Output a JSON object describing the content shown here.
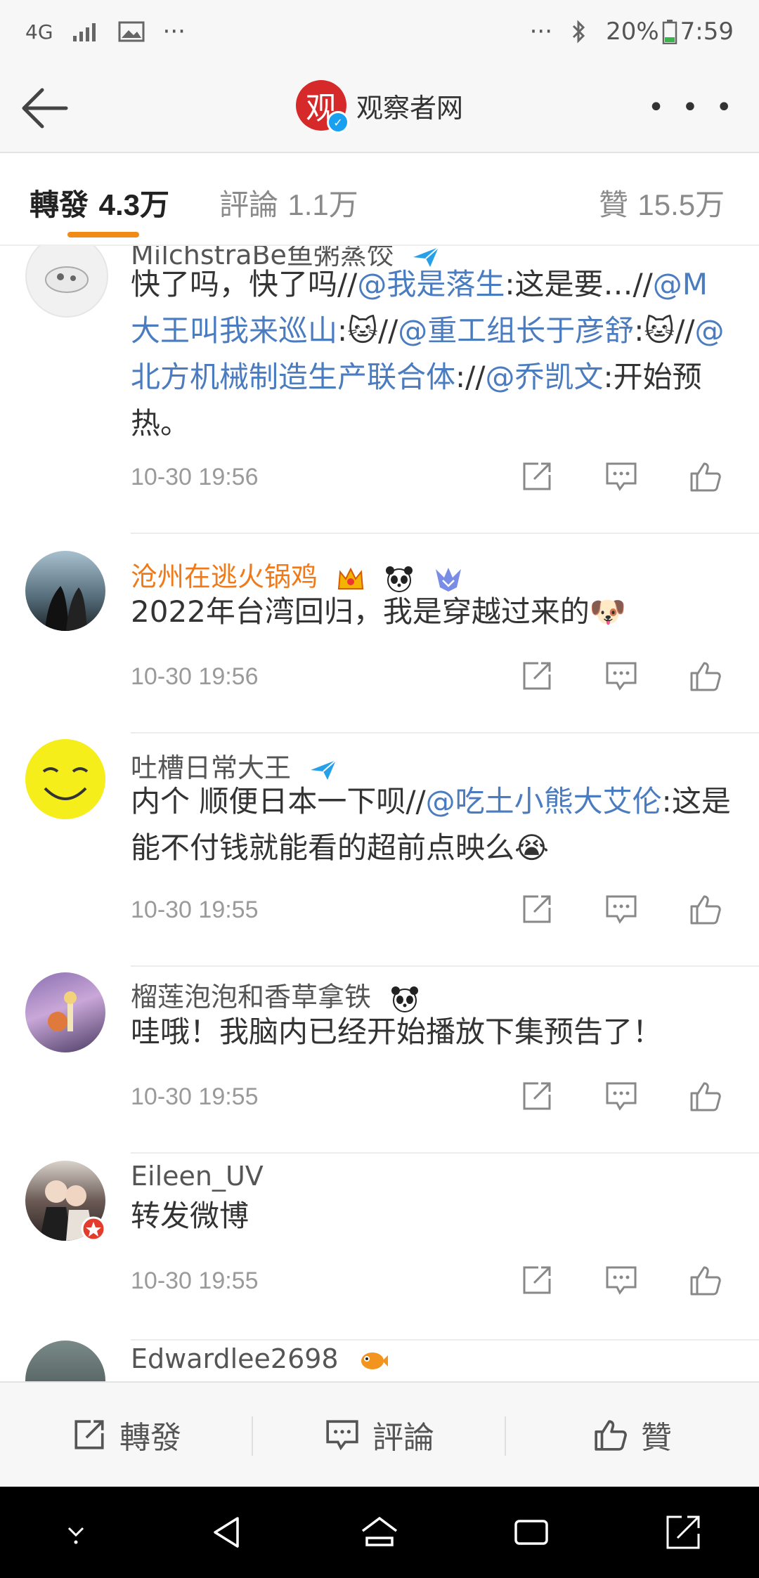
{
  "status_bar": {
    "network": "4G",
    "battery": "20%",
    "time": "7:59"
  },
  "header": {
    "title": "观察者网",
    "logo_text": "观"
  },
  "tabs": [
    {
      "label": "轉發",
      "count": "4.3万"
    },
    {
      "label": "評論",
      "count": "1.1万"
    },
    {
      "label": "贊",
      "count": "15.5万"
    }
  ],
  "comments": [
    {
      "user": "MilchstraBe鱼粥蒸饺",
      "text_parts": [
        "快了吗，快了吗//",
        "@我是落生",
        ":这是要…//",
        "@M大王叫我来巡山",
        ":🐱//",
        "@重工组长于彦舒",
        ":🐱//",
        "@北方机械制造生产联合体",
        "://",
        "@乔凯文",
        ":开始预热。"
      ],
      "time": "10-30 19:56"
    },
    {
      "user": "沧州在逃火锅鸡",
      "text": "2022年台湾回归，我是穿越过来的🐶",
      "time": "10-30 19:56"
    },
    {
      "user": "吐槽日常大王",
      "text_parts": [
        "内个 顺便日本一下呗//",
        "@吃土小熊大艾伦",
        ":这是能不付钱就能看的超前点映么😭"
      ],
      "time": "10-30 19:55"
    },
    {
      "user": "榴莲泡泡和香草拿铁",
      "text": "哇哦！我脑内已经开始播放下集预告了！",
      "time": "10-30 19:55"
    },
    {
      "user": "Eileen_UV",
      "text": "转发微博",
      "time": "10-30 19:55"
    },
    {
      "user": "Edwardlee2698"
    }
  ],
  "bottom_bar": {
    "repost": "轉發",
    "comment": "評論",
    "like": "贊"
  },
  "colors": {
    "accent": "#f08b17",
    "mention": "#4b7cbf",
    "orange_name": "#f07a1a"
  }
}
